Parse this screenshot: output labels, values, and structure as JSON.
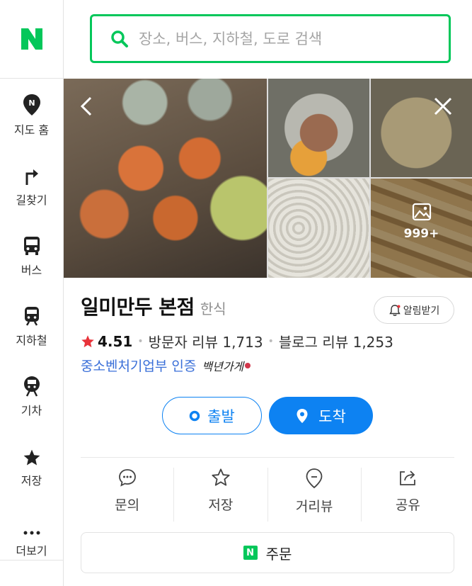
{
  "brand": {
    "logo_letter": "N",
    "color": "#03c75a"
  },
  "sidebar": {
    "items": [
      {
        "label": "지도 홈",
        "icon": "map-pin-icon"
      },
      {
        "label": "길찾기",
        "icon": "turn-arrow-icon"
      },
      {
        "label": "버스",
        "icon": "bus-icon"
      },
      {
        "label": "지하철",
        "icon": "subway-icon"
      },
      {
        "label": "기차",
        "icon": "train-icon"
      },
      {
        "label": "저장",
        "icon": "star-icon"
      },
      {
        "label": "더보기",
        "icon": "more-dots-icon"
      }
    ]
  },
  "search": {
    "placeholder": "장소, 버스, 지하철, 도로 검색"
  },
  "gallery": {
    "more_count": "999+"
  },
  "place": {
    "name": "일미만두 본점",
    "category": "한식",
    "rating": "4.51",
    "visitor_reviews": "방문자 리뷰 1,713",
    "blog_reviews": "블로그 리뷰 1,253",
    "certification": "중소벤처기업부 인증",
    "badge": "백년가게"
  },
  "buttons": {
    "alarm": "알림받기",
    "depart": "출발",
    "arrive": "도착",
    "order": "주문"
  },
  "actions": [
    {
      "label": "문의",
      "icon": "chat-bubble-icon"
    },
    {
      "label": "저장",
      "icon": "star-outline-icon"
    },
    {
      "label": "거리뷰",
      "icon": "location-pin-outline-icon"
    },
    {
      "label": "공유",
      "icon": "share-icon"
    }
  ],
  "colors": {
    "accent_green": "#03c75a",
    "accent_blue": "#0d82f2",
    "rating_star": "#e8333a",
    "cert_link": "#3a6fd8"
  }
}
